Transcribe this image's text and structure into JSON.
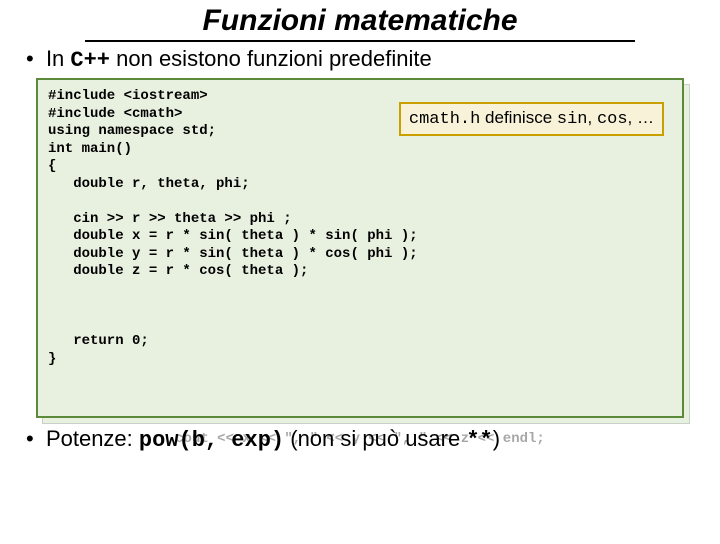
{
  "title": "Funzioni matematiche",
  "bullet1_pre": "In ",
  "bullet1_cpp": "C++",
  "bullet1_post": " non esistono funzioni predefinite",
  "code": {
    "l1": "#include <iostream>",
    "l2": "#include <cmath>",
    "l3": "using namespace std;",
    "l4": "int main()",
    "l5": "{",
    "l6": "   double r, theta, phi;",
    "blank1": " ",
    "l7": "   cin >> r >> theta >> phi ;",
    "l8": "   double x = r * sin( theta ) * sin( phi );",
    "l9": "   double y = r * sin( theta ) * cos( phi );",
    "l10": "   double z = r * cos( theta );",
    "blank2": " ",
    "blank3": " ",
    "blank4": " ",
    "l11": "   return 0;",
    "l12": "}"
  },
  "callout": {
    "p1": "cmath.h",
    "p2": " definisce ",
    "p3": "sin",
    "p4": ", ",
    "p5": "cos",
    "p6": ", …"
  },
  "ghost_line": "cout << x << \", \" << y << \", \" << z << endl;",
  "bullet2": {
    "pre": "Potenze: ",
    "pow": "pow(b, exp)",
    "mid": " (non si può usare ",
    "star": "**",
    "end": ")"
  }
}
